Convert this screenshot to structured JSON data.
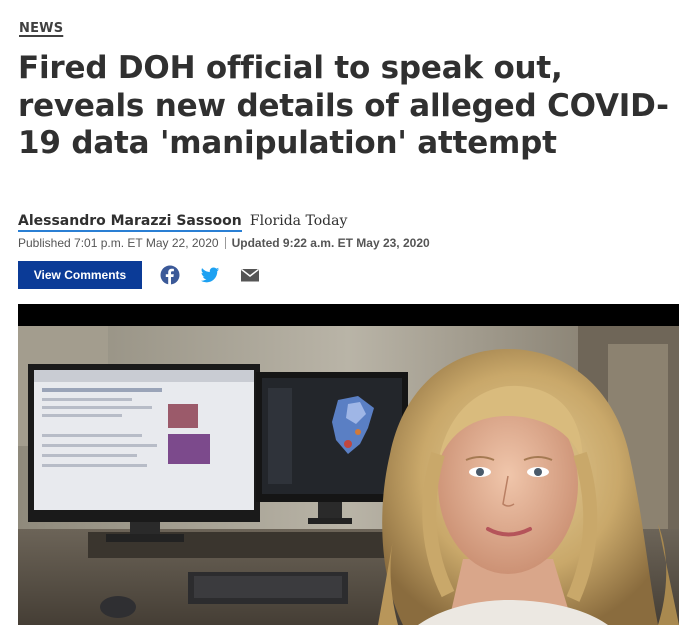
{
  "article": {
    "section": "NEWS",
    "headline": "Fired DOH official to speak out, reveals new details of alleged COVID-19 data 'manipulation' attempt",
    "author": "Alessandro Marazzi Sassoon",
    "publication": "Florida Today",
    "published": "Published 7:01 p.m. ET May 22, 2020",
    "updated": "Updated 9:22 a.m. ET May 23, 2020"
  },
  "actions": {
    "comments_label": "View Comments",
    "share_icons": [
      "facebook-icon",
      "twitter-icon",
      "email-icon"
    ]
  },
  "colors": {
    "comments_button": "#0b3b97",
    "facebook": "#3b5998",
    "twitter": "#1da1f2",
    "email": "#555555",
    "author_underline": "#2a7fd4"
  }
}
